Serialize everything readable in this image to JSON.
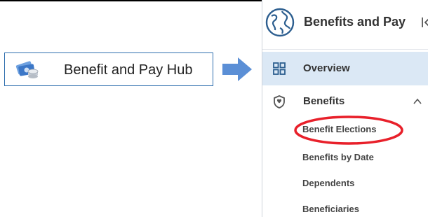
{
  "hub": {
    "label": "Benefit and Pay Hub",
    "icon": "money-icon"
  },
  "arrow": {
    "icon": "right-arrow-icon",
    "color": "#5b8fd6"
  },
  "panel": {
    "title": "Benefits and Pay",
    "header_icon": "globe-icon",
    "collapse_icon": "collapse-panel-icon",
    "nav": [
      {
        "label": "Overview",
        "icon": "grid-icon",
        "selected": true
      },
      {
        "label": "Benefits",
        "icon": "shield-icon",
        "expanded": true
      }
    ],
    "benefits_subitems": [
      "Benefit Elections",
      "Benefits by Date",
      "Dependents",
      "Beneficiaries"
    ]
  },
  "highlight": {
    "target": "Benefit Elections",
    "color": "#e8202a"
  },
  "colors": {
    "selected_bg": "#dbe8f5",
    "card_border": "#2f6fae",
    "text": "#333333"
  }
}
